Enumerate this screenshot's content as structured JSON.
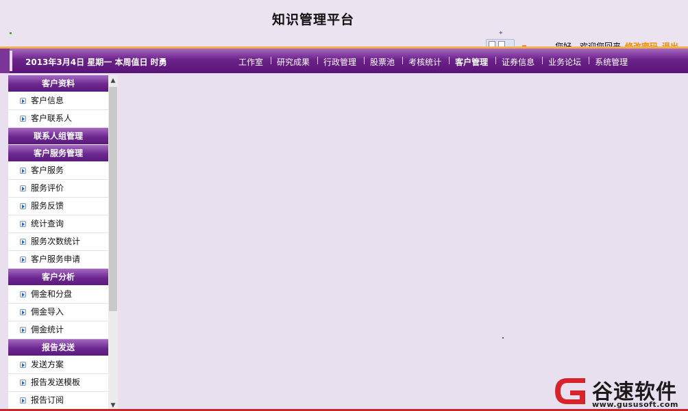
{
  "header": {
    "title": "知识管理平台",
    "welcome": "您好，欢迎您回来",
    "change_password": "修改密码",
    "logout": "退出"
  },
  "navbar": {
    "date": "2013年3月4日  星期一  本周值日  时勇",
    "items": [
      {
        "label": "工作室"
      },
      {
        "label": "研究成果"
      },
      {
        "label": "行政管理"
      },
      {
        "label": "股票池"
      },
      {
        "label": "考核统计"
      },
      {
        "label": "客户管理",
        "active": true
      },
      {
        "label": "证券信息"
      },
      {
        "label": "业务论坛"
      },
      {
        "label": "系统管理"
      }
    ]
  },
  "sidebar": {
    "sections": [
      {
        "title": "客户资料",
        "items": [
          "客户信息",
          "客户联系人"
        ]
      },
      {
        "title": "联系人组管理",
        "items": []
      },
      {
        "title": "客户服务管理",
        "items": [
          "客户服务",
          "服务评价",
          "服务反馈",
          "统计查询",
          "服务次数统计",
          "客户服务申请"
        ]
      },
      {
        "title": "客户分析",
        "items": [
          "佣金和分盘",
          "佣金导入",
          "佣金统计"
        ]
      },
      {
        "title": "报告发送",
        "items": [
          "发送方案",
          "报告发送模板",
          "报告订阅"
        ]
      }
    ]
  },
  "watermark": {
    "name": "谷速软件",
    "url": "www.gususoft.com"
  },
  "colors": {
    "nav_purple": "#6b2289",
    "accent_orange": "#f09000",
    "background": "#e8e0ef",
    "logo_red": "#d8232a"
  }
}
